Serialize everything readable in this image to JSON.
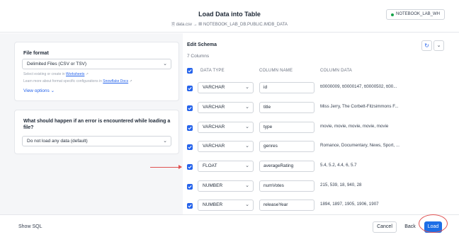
{
  "header": {
    "title": "Load Data into Table",
    "source_file": "data.csv",
    "arrow": "→",
    "target_table": "NOTEBOOK_LAB_DB.PUBLIC.IMDB_DATA",
    "warehouse": "NOTEBOOK_LAB_WH"
  },
  "file_format": {
    "label": "File format",
    "selected": "Delimited Files (CSV or TSV)",
    "hint1_prefix": "Select existing or create in ",
    "hint1_link": "Worksheets",
    "hint2_prefix": "Learn more about format specific configurations in ",
    "hint2_link": "Snowflake Docs",
    "view_options": "View options"
  },
  "error_handling": {
    "label": "What should happen if an error is encountered while loading a file?",
    "selected": "Do not load any data (default)"
  },
  "schema": {
    "title": "Edit Schema",
    "count": "7 Columns",
    "col_type": "DATA TYPE",
    "col_name": "COLUMN NAME",
    "col_data": "COLUMN DATA",
    "rows": [
      {
        "type": "VARCHAR",
        "name": "id",
        "data": "tt0000009, tt0000147, tt0000502, tt00..."
      },
      {
        "type": "VARCHAR",
        "name": "title",
        "data": "Miss Jerry, The Corbett-Fitzsimmons F..."
      },
      {
        "type": "VARCHAR",
        "name": "type",
        "data": "movie, movie, movie, movie, movie"
      },
      {
        "type": "VARCHAR",
        "name": "genres",
        "data": "Romance, Documentary, News, Sport, ..."
      },
      {
        "type": "FLOAT",
        "name": "averageRating",
        "data": "5.4, 5.2, 4.4, 6, 5.7"
      },
      {
        "type": "NUMBER",
        "name": "numVotes",
        "data": "215, 539, 18, 940, 28"
      },
      {
        "type": "NUMBER",
        "name": "releaseYear",
        "data": "1894, 1897, 1905, 1906, 1907"
      }
    ]
  },
  "footer": {
    "show_sql": "Show SQL",
    "cancel": "Cancel",
    "back": "Back",
    "load": "Load"
  },
  "colors": {
    "accent": "#1d6ee6",
    "annotation": "#e05252"
  }
}
